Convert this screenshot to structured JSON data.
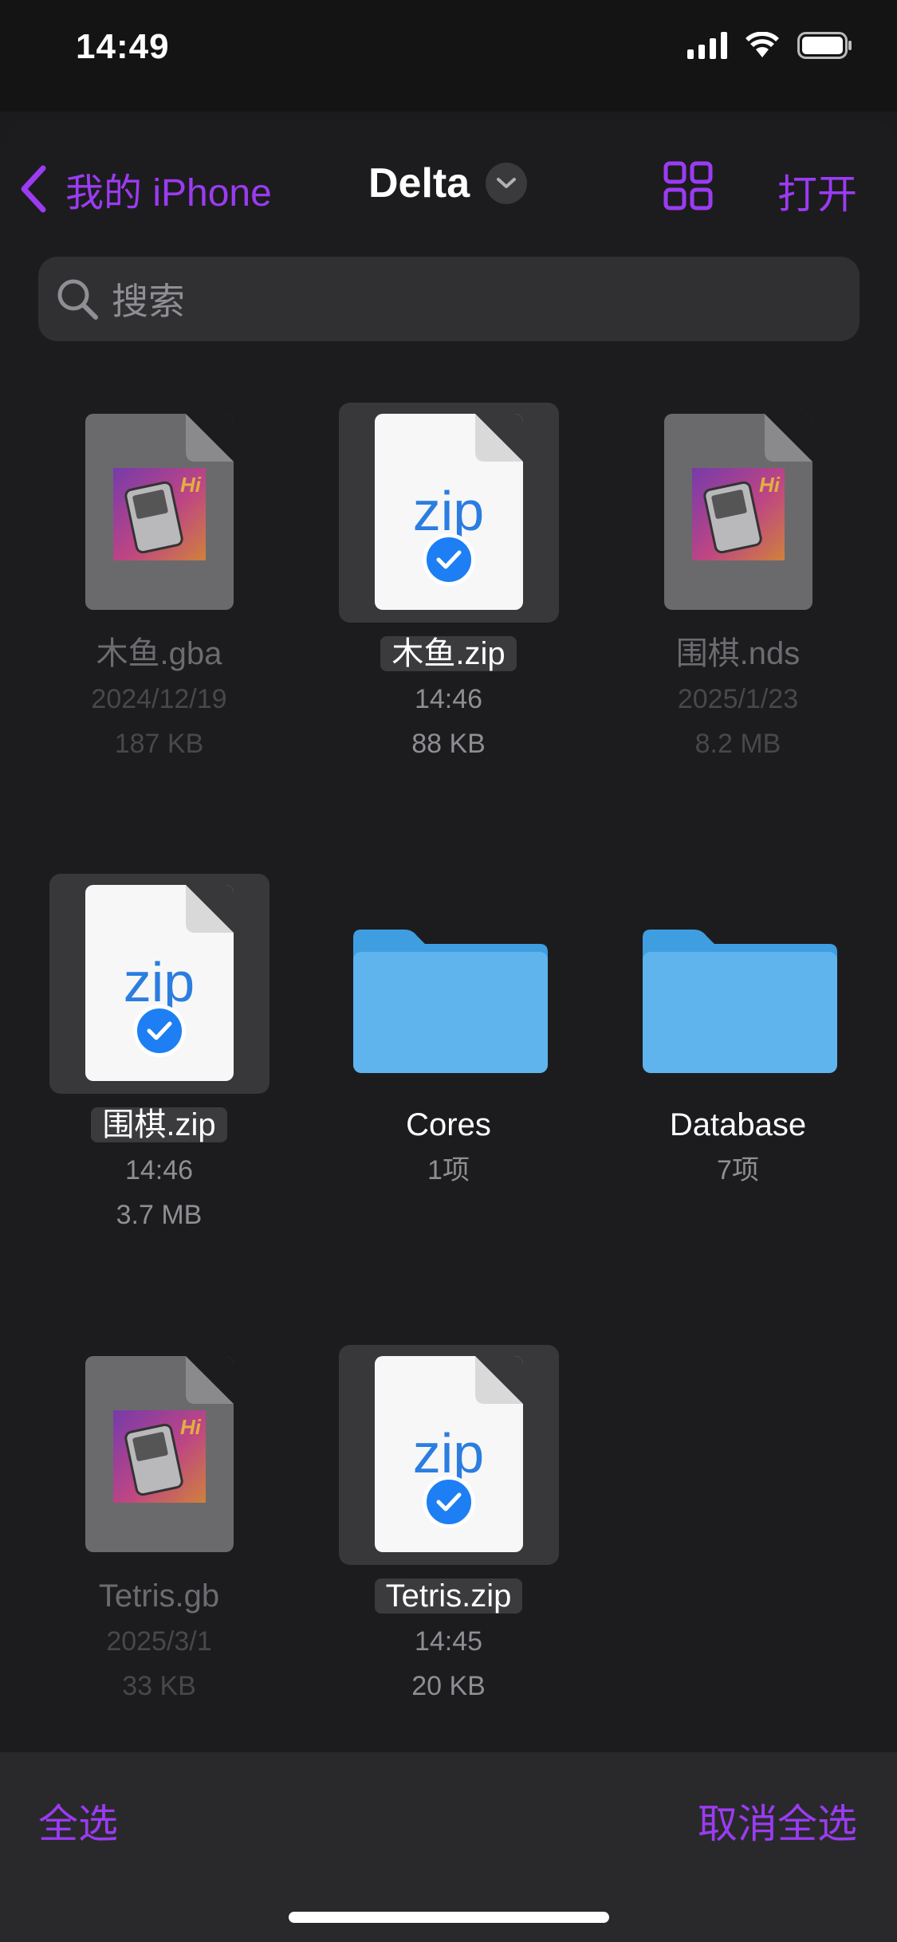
{
  "status_bar": {
    "time": "14:49"
  },
  "nav": {
    "back_label": "我的 iPhone",
    "title": "Delta",
    "open_label": "打开"
  },
  "search": {
    "placeholder": "搜索"
  },
  "files": [
    {
      "name": "木鱼.gba",
      "line1": "2024/12/19",
      "line2": "187 KB"
    },
    {
      "name": "木鱼.zip",
      "line1": "14:46",
      "line2": "88 KB",
      "thumb_text": "zip"
    },
    {
      "name": "围棋.nds",
      "line1": "2025/1/23",
      "line2": "8.2 MB"
    },
    {
      "name": "围棋.zip",
      "line1": "14:46",
      "line2": "3.7 MB",
      "thumb_text": "zip"
    },
    {
      "name": "Cores",
      "line1": "1项"
    },
    {
      "name": "Database",
      "line1": "7项"
    },
    {
      "name": "Tetris.gb",
      "line1": "2025/3/1",
      "line2": "33 KB"
    },
    {
      "name": "Tetris.zip",
      "line1": "14:45",
      "line2": "20 KB",
      "thumb_text": "zip"
    }
  ],
  "bottom_bar": {
    "select_all": "全选",
    "deselect_all": "取消全选"
  },
  "colors": {
    "accent": "#9b3bf2",
    "zip_blue": "#2b7de0",
    "folder_blue": "#5fb4ee"
  }
}
